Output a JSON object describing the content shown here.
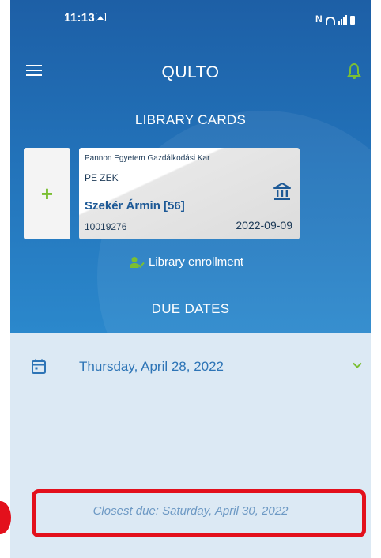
{
  "status_bar": {
    "time": "11:13",
    "image_icon": "image-icon",
    "nfc_text": "N",
    "icons": [
      "nfc-icon",
      "wifi-icon",
      "signal-icon",
      "battery-icon"
    ]
  },
  "app_bar": {
    "title": "QULTO",
    "menu_icon": "hamburger-menu-icon",
    "notification_icon": "bell-icon"
  },
  "library_cards": {
    "section_title": "LIBRARY CARDS",
    "add_label": "+",
    "card": {
      "institution": "Pannon Egyetem Gazdálkodási Kar",
      "code": "PE ZEK",
      "holder_name": "Szekér Ármin [56]",
      "card_number": "10019276",
      "expiry": "2022-09-09",
      "icon": "bank-building-icon"
    },
    "enrollment_label": "Library enrollment",
    "enrollment_icon": "user-check-icon"
  },
  "due_dates": {
    "section_title": "DUE DATES",
    "rows": [
      {
        "date": "Thursday, April 28, 2022",
        "icon": "calendar-icon",
        "toggle_icon": "chevron-down-icon"
      }
    ],
    "closest_due": "Closest due: Saturday, April 30, 2022"
  },
  "colors": {
    "header_blue": "#1d5fa6",
    "accent_green": "#7bbf33",
    "link_blue": "#2d74b6",
    "highlight_red": "#e3101c",
    "background": "#dce9f4"
  }
}
